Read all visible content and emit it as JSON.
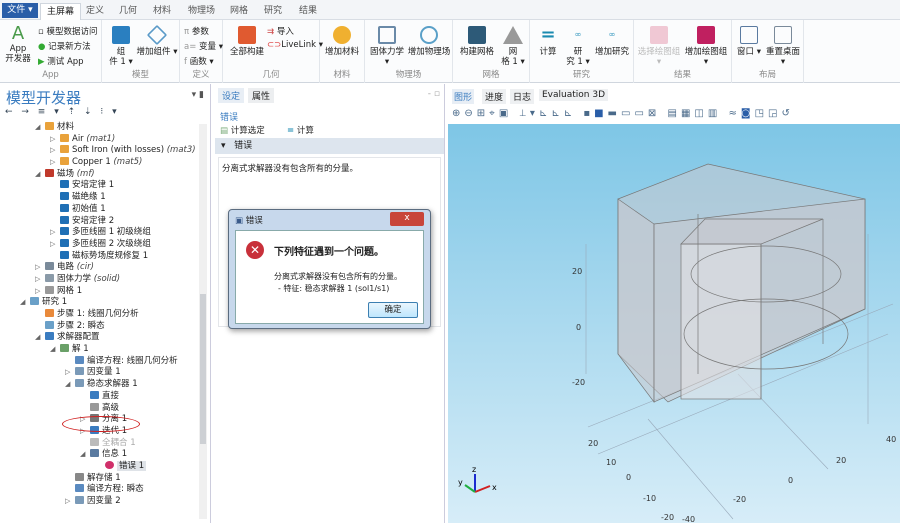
{
  "menubar": {
    "file": "文件 ▾",
    "tabs": [
      "主屏幕",
      "定义",
      "几何",
      "材料",
      "物理场",
      "网格",
      "研究",
      "结果"
    ],
    "active_tab": 0
  },
  "ribbon": {
    "app": {
      "label": "App",
      "app_dev": "App\n开发器",
      "items": [
        "模型数据访问",
        "记录新方法",
        "测试 App"
      ]
    },
    "model": {
      "label": "模型",
      "component": "组\n件 1 ▾",
      "add_component": "增加组件 ▾"
    },
    "definitions": {
      "label": "定义",
      "items": [
        "参数",
        "变量 ▾",
        "函数 ▾"
      ]
    },
    "geometry": {
      "label": "几何",
      "build_all": "全部构建",
      "import": "导入",
      "livelink": "LiveLink ▾"
    },
    "materials": {
      "label": "材料",
      "add_material": "增加材料"
    },
    "physics": {
      "label": "物理场",
      "solid": "固体力学 ▾",
      "add_physics": "增加物理场"
    },
    "mesh": {
      "label": "网格",
      "build_mesh": "构建网格",
      "mesh1": "网\n格 1 ▾"
    },
    "study": {
      "label": "研究",
      "compute": "计算",
      "study1": "研\n究 1 ▾",
      "add_study": "增加研究"
    },
    "results": {
      "label": "结果",
      "select_plot": "选择绘图组 ▾",
      "add_plot": "增加绘图组 ▾"
    },
    "layout": {
      "label": "布局",
      "windows": "窗口 ▾",
      "reset": "重置桌面 ▾"
    }
  },
  "model_builder": {
    "title": "模型开发器",
    "tools": "← → ≡ ▾ ⇡ ⇣ ⁝ ▾",
    "tree": [
      {
        "l": 1,
        "t": "▲",
        "c": "#e9a23b",
        "label": "材料"
      },
      {
        "l": 2,
        "t": "▷",
        "c": "#e9a23b",
        "label": "Air",
        "sub": "(mat1)"
      },
      {
        "l": 2,
        "t": "▷",
        "c": "#e9a23b",
        "label": "Soft Iron (with losses)",
        "sub": "(mat3)"
      },
      {
        "l": 2,
        "t": "▷",
        "c": "#e9a23b",
        "label": "Copper 1",
        "sub": "(mat5)"
      },
      {
        "l": 1,
        "t": "▲",
        "c": "#c0392b",
        "label": "磁场",
        "sub": "(mf)"
      },
      {
        "l": 2,
        "t": "",
        "c": "#1f6fb5",
        "label": "安培定律 1"
      },
      {
        "l": 2,
        "t": "",
        "c": "#1f6fb5",
        "label": "磁绝缘 1"
      },
      {
        "l": 2,
        "t": "",
        "c": "#1f6fb5",
        "label": "初始值 1"
      },
      {
        "l": 2,
        "t": "",
        "c": "#1f6fb5",
        "label": "安培定律 2"
      },
      {
        "l": 2,
        "t": "▷",
        "c": "#1f6fb5",
        "label": "多匝线圈 1 初级绕组"
      },
      {
        "l": 2,
        "t": "▷",
        "c": "#1f6fb5",
        "label": "多匝线圈 2 次级绕组"
      },
      {
        "l": 2,
        "t": "",
        "c": "#1f6fb5",
        "label": "磁标势场度规修复 1"
      },
      {
        "l": 1,
        "t": "▷",
        "c": "#7a8a9a",
        "label": "电路",
        "sub": "(cir)"
      },
      {
        "l": 1,
        "t": "▷",
        "c": "#8a9aa8",
        "label": "固体力学",
        "sub": "(solid)"
      },
      {
        "l": 1,
        "t": "▷",
        "c": "#999",
        "label": "网格 1"
      },
      {
        "l": 0,
        "t": "▲",
        "c": "#6aa0c8",
        "label": "研究 1"
      },
      {
        "l": 1,
        "t": "",
        "c": "#e98a3b",
        "label": "步骤 1: 线圈几何分析"
      },
      {
        "l": 1,
        "t": "",
        "c": "#6aa0c8",
        "label": "步骤 2: 瞬态"
      },
      {
        "l": 1,
        "t": "▲",
        "c": "#3a7cc0",
        "label": "求解器配置"
      },
      {
        "l": 2,
        "t": "▲",
        "c": "#6aa068",
        "label": "解 1"
      },
      {
        "l": 3,
        "t": "",
        "c": "#5a8ac0",
        "label": "编译方程: 线圈几何分析"
      },
      {
        "l": 3,
        "t": "▷",
        "c": "#7a9ab8",
        "label": "因变量 1"
      },
      {
        "l": 3,
        "t": "▲",
        "c": "#7a9ab8",
        "label": "稳态求解器 1"
      },
      {
        "l": 4,
        "t": "",
        "c": "#3a7cc0",
        "label": "直接"
      },
      {
        "l": 4,
        "t": "",
        "c": "#999",
        "label": "高级"
      },
      {
        "l": 4,
        "t": "▷",
        "c": "#777",
        "label": "分离 1",
        "circled": true
      },
      {
        "l": 4,
        "t": "▷",
        "c": "#3a7cc0",
        "label": "迭代 1"
      },
      {
        "l": 4,
        "t": "",
        "c": "#bbb",
        "label": "全耦合 1",
        "dim": true
      },
      {
        "l": 4,
        "t": "▲",
        "c": "#5a7aa0",
        "label": "信息 1"
      },
      {
        "l": 5,
        "t": "",
        "c": "#d0306a",
        "label": "错误 1",
        "selected": true
      },
      {
        "l": 3,
        "t": "",
        "c": "#888",
        "label": "解存储 1"
      },
      {
        "l": 3,
        "t": "",
        "c": "#5a8ac0",
        "label": "编译方程: 瞬态"
      },
      {
        "l": 3,
        "t": "▷",
        "c": "#7a9ab8",
        "label": "因变量 2"
      }
    ]
  },
  "settings": {
    "tabs": [
      "设定",
      "属性"
    ],
    "section_title": "错误",
    "compute_selected": "计算选定",
    "compute": "计算",
    "error_header": "错误",
    "error_text": "分离式求解器没有包含所有的分量。"
  },
  "dialog": {
    "title": "错误",
    "heading": "下列特征遇到一个问题。",
    "message": "分离式求解器没有包含所有的分量。",
    "feature": "- 特征: 稳态求解器 1 (sol1/s1)",
    "ok": "确定",
    "close": "x"
  },
  "graphics": {
    "tabs": [
      "图形",
      "进度",
      "日志",
      "Evaluation 3D"
    ],
    "axis_labels": {
      "z20": "20",
      "z0": "0",
      "zm20": "-20",
      "y20": "20",
      "y10": "10",
      "y0": "0",
      "ym10": "-10",
      "ym20": "-20",
      "xm40": "-40",
      "xm20": "-20",
      "x0": "0",
      "x20": "20",
      "x40": "40"
    },
    "triad": {
      "x": "x",
      "y": "y",
      "z": "z"
    }
  }
}
